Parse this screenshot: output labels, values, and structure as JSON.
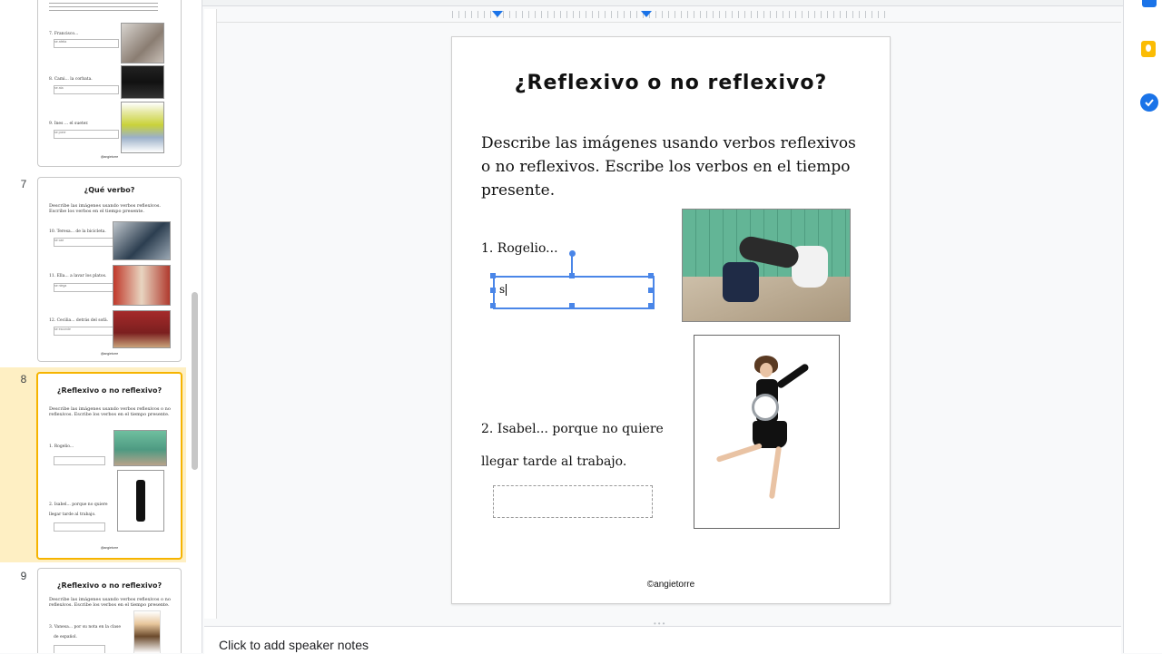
{
  "filmstrip": {
    "slides": [
      {
        "number": "",
        "title": "",
        "items": [
          "7.   Francisco...",
          "8.   Cami... la corbata.",
          "9.   Ines ... el sueter."
        ],
        "box_values": [
          "se afeita",
          "se ata",
          "se pone"
        ],
        "footer": "@angietorre"
      },
      {
        "number": "7",
        "title": "¿Qué verbo?",
        "intro": "Describe las imágenes usando verbos reflexivos. Escribe los verbos en el tiempo presente.",
        "items": [
          "10.  Teresa... de la bicicleta.",
          "11.  Ella... a lavar los platos.",
          "12.  Cecilia... detrás del sofá."
        ],
        "box_values": [
          "se cae",
          "se niega",
          "se esconde"
        ],
        "footer": "@angietorre"
      },
      {
        "number": "8",
        "title": "¿Reflexivo o no reflexivo?",
        "intro": "Describe las imágenes usando verbos reflexivos o no reflexivos. Escribe los verbos en el tiempo presente.",
        "items": [
          "1.   Rogelio...",
          "2.   Isabel... porque no quiere",
          "llegar tarde al trabajo."
        ],
        "footer": "@angietorre"
      },
      {
        "number": "9",
        "title": "¿Reflexivo o no reflexivo?",
        "intro": "Describe las imágenes usando verbos reflexivos o no reflexivos. Escribe los verbos en el tiempo presente.",
        "items": [
          "3.   Vanesa... por su nota en la clase",
          "de español."
        ],
        "footer": ""
      }
    ]
  },
  "slide": {
    "title": "¿Reflexivo o no reflexivo?",
    "instructions": "Describe las imágenes usando verbos reflexivos o no reflexivos. Escribe los verbos en el tiempo presente.",
    "item1": "1.    Rogelio...",
    "answer1": "s",
    "item2_line1": "2.    Isabel... porque no quiere",
    "item2_line2": "llegar tarde al trabajo.",
    "copyright": "©angietorre"
  },
  "notes": {
    "placeholder": "Click to add speaker notes"
  },
  "colors": {
    "accent": "#4a86e8",
    "selected_slide": "#feefc3",
    "selected_border": "#f6b400"
  },
  "side_panel": {
    "icons": [
      "calendar-icon",
      "keep-icon",
      "tasks-icon"
    ]
  }
}
